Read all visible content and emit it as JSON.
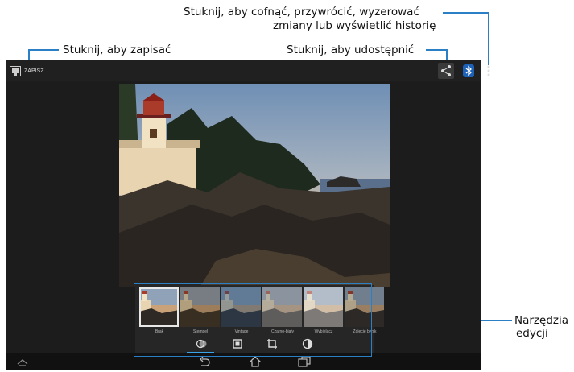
{
  "callouts": {
    "undo_line1": "Stuknij, aby cofnąć, przywrócić, wyzerować",
    "undo_line2": "zmiany lub wyświetlić historię",
    "save": "Stuknij, aby zapisać",
    "share": "Stuknij, aby udostępnić",
    "tools_line1": "Narzędzia",
    "tools_line2": "edycji"
  },
  "actionbar": {
    "save_label": "ZAPISZ",
    "icons": [
      "save-icon",
      "share-icon",
      "bluetooth-icon",
      "more-icon"
    ]
  },
  "filters": [
    {
      "label": "Brak",
      "selected": true
    },
    {
      "label": "Stempel",
      "selected": false
    },
    {
      "label": "Vintage",
      "selected": false
    },
    {
      "label": "Czarno-biały",
      "selected": false
    },
    {
      "label": "Wybielacz",
      "selected": false
    },
    {
      "label": "Zdjęcie błysk",
      "selected": false
    }
  ],
  "tools": [
    "effects-icon",
    "frame-icon",
    "crop-icon",
    "adjust-icon"
  ],
  "navbar": [
    "home-logo-icon",
    "back-icon",
    "home-icon",
    "recent-apps-icon"
  ],
  "colors": {
    "accent": "#2a7fc5",
    "tab_underline": "#3ba4e8"
  }
}
